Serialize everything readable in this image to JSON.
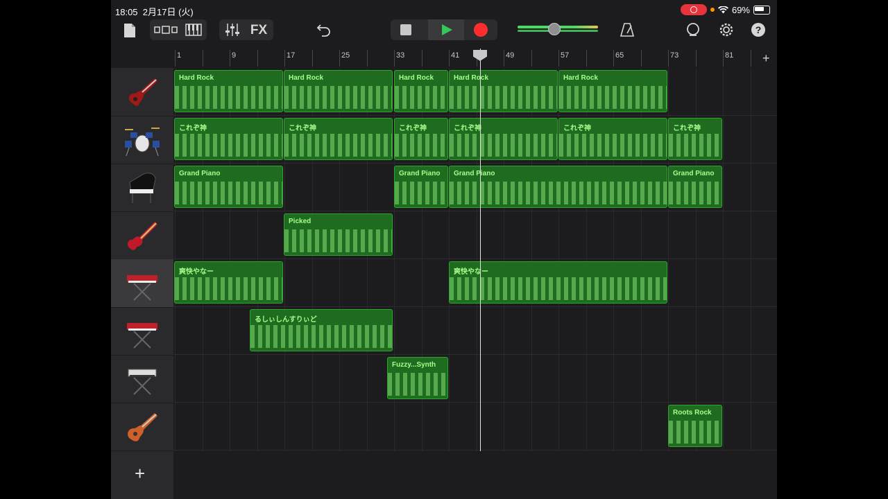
{
  "status": {
    "time": "18:05",
    "date": "2月17日 (火)",
    "battery": "69%"
  },
  "ruler": {
    "labels": [
      "1",
      "9",
      "17",
      "25",
      "33",
      "41",
      "49",
      "57",
      "65",
      "73",
      "81"
    ]
  },
  "tracks": [
    {
      "instrument": "electric-guitar",
      "regions": [
        {
          "name": "Hard Rock"
        },
        {
          "name": "Hard Rock"
        },
        {
          "name": "Hard Rock"
        },
        {
          "name": "Hard Rock"
        },
        {
          "name": "Hard Rock"
        }
      ]
    },
    {
      "instrument": "drum-kit",
      "regions": [
        {
          "name": "これぞ神"
        },
        {
          "name": "これぞ神"
        },
        {
          "name": "これぞ神"
        },
        {
          "name": "これぞ神"
        },
        {
          "name": "これぞ神"
        },
        {
          "name": "これぞ神"
        }
      ]
    },
    {
      "instrument": "grand-piano",
      "regions": [
        {
          "name": "Grand Piano"
        },
        {
          "name": "Grand Piano"
        },
        {
          "name": "Grand Piano"
        },
        {
          "name": "Grand Piano"
        }
      ]
    },
    {
      "instrument": "bass",
      "regions": [
        {
          "name": "Picked"
        }
      ]
    },
    {
      "instrument": "keyboard",
      "regions": [
        {
          "name": "爽快やなー"
        },
        {
          "name": "爽快やなー"
        }
      ]
    },
    {
      "instrument": "keyboard-2",
      "regions": [
        {
          "name": "るしぃしんすりぃど"
        }
      ]
    },
    {
      "instrument": "synth",
      "regions": [
        {
          "name": "Fuzzy...Synth"
        }
      ]
    },
    {
      "instrument": "guitar-2",
      "regions": [
        {
          "name": "Roots Rock"
        }
      ]
    }
  ],
  "colors": {
    "region_fill": "#1f6b1f",
    "region_border": "#2fa52f",
    "region_text": "#a6ff8c",
    "record": "#ff2d2d",
    "play": "#34c759"
  }
}
